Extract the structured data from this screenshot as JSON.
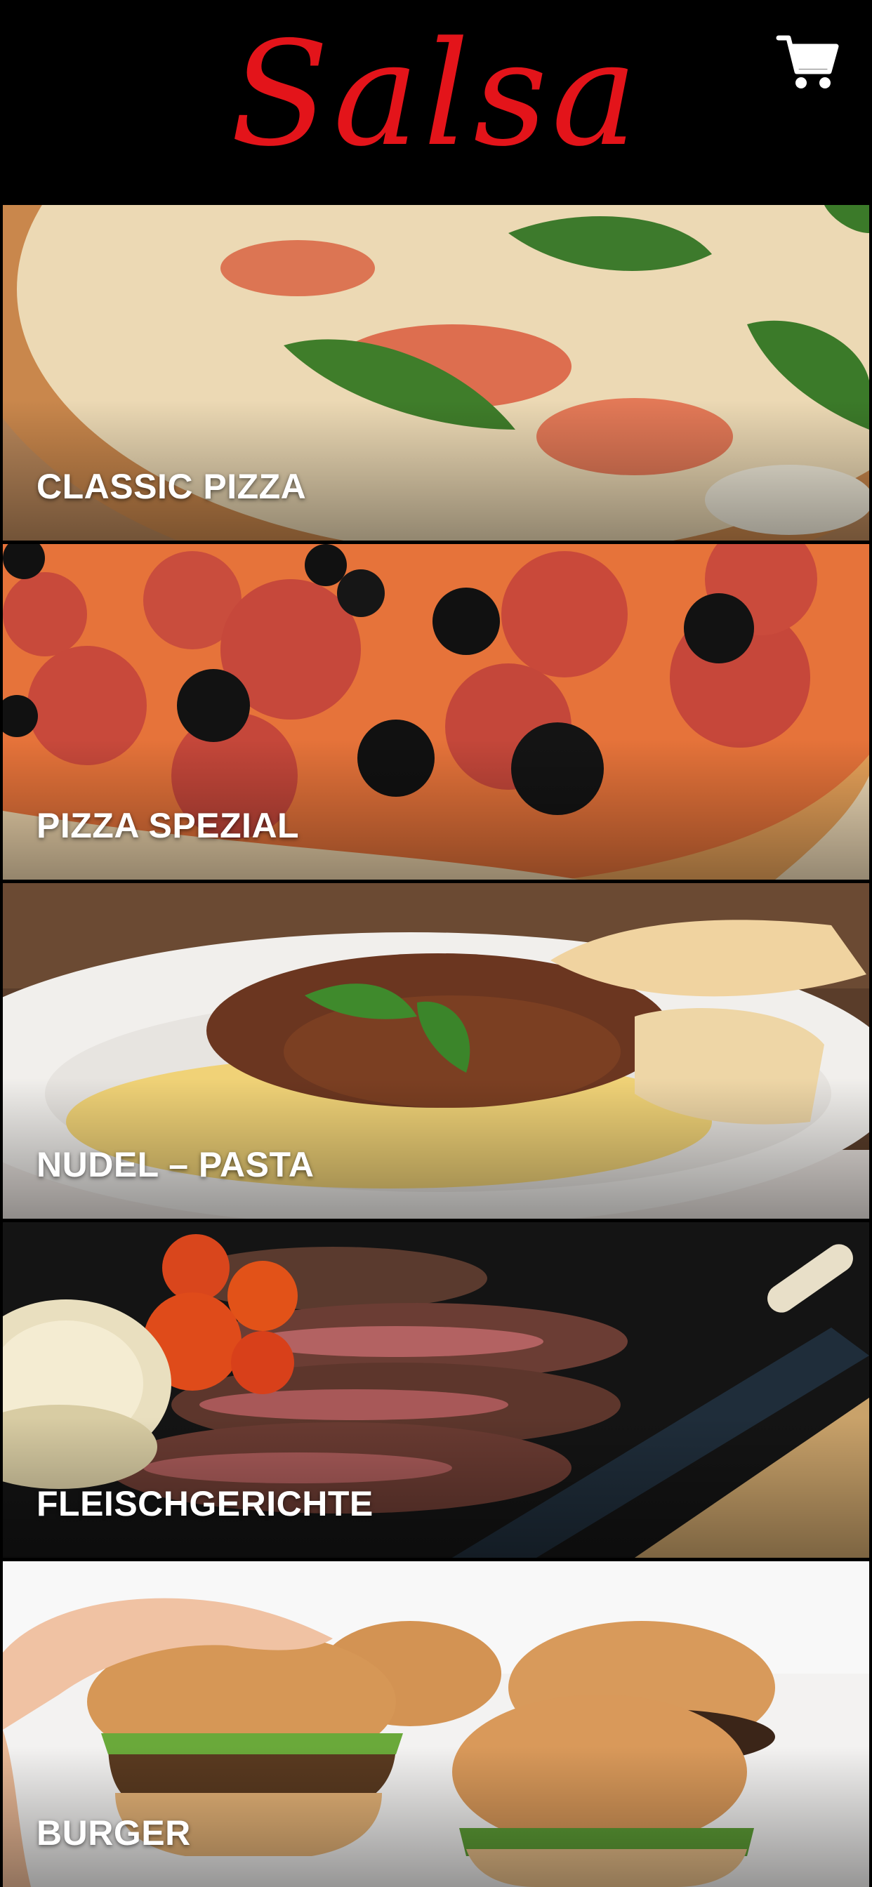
{
  "header": {
    "logo_text": "Salsa",
    "cart_icon": "shopping-cart-icon"
  },
  "categories": [
    {
      "label": "CLASSIC PIZZA"
    },
    {
      "label": "PIZZA SPEZIAL"
    },
    {
      "label": "NUDEL – PASTA"
    },
    {
      "label": "FLEISCHGERICHTE"
    },
    {
      "label": "BURGER"
    }
  ],
  "colors": {
    "background": "#000000",
    "logo": "#e3141a",
    "label_text": "#ffffff",
    "cart_icon": "#ffffff"
  }
}
